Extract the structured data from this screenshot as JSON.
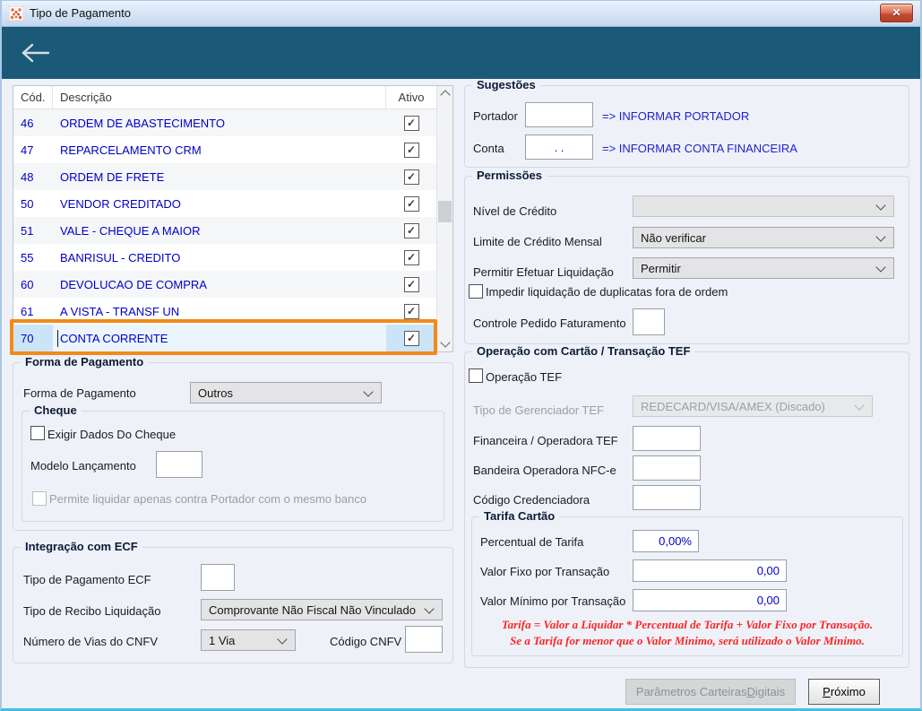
{
  "colors": {
    "header_teal": "#1A5A78",
    "highlight_orange": "#F28A1A",
    "link_blue": "#0000C8",
    "warning_red": "#FB2626",
    "selected_row_bg": "#CBE4F7"
  },
  "icons": {
    "check": "✓",
    "close": "✕"
  },
  "window": {
    "title": "Tipo de Pagamento"
  },
  "table": {
    "headers": {
      "code": "Cód.",
      "description": "Descrição",
      "active": "Ativo"
    },
    "rows": [
      {
        "code": "46",
        "desc": "ORDEM DE ABASTECIMENTO",
        "active": true
      },
      {
        "code": "47",
        "desc": "REPARCELAMENTO CRM",
        "active": true
      },
      {
        "code": "48",
        "desc": "ORDEM DE FRETE",
        "active": true
      },
      {
        "code": "50",
        "desc": "VENDOR CREDITADO",
        "active": true
      },
      {
        "code": "51",
        "desc": "VALE - CHEQUE  A MAIOR",
        "active": true
      },
      {
        "code": "55",
        "desc": "BANRISUL - CREDITO",
        "active": true
      },
      {
        "code": "60",
        "desc": "DEVOLUCAO DE COMPRA",
        "active": true
      },
      {
        "code": "61",
        "desc": "A VISTA - TRANSF UN",
        "active": true
      },
      {
        "code": "70",
        "desc": "CONTA CORRENTE",
        "active": true,
        "selected": true
      }
    ]
  },
  "forma_pagamento": {
    "group_title": "Forma de Pagamento",
    "label": "Forma de Pagamento",
    "value": "Outros",
    "cheque": {
      "group_title": "Cheque",
      "exigir_label": "Exigir Dados Do Cheque",
      "exigir_checked": false,
      "modelo_label": "Modelo Lançamento",
      "modelo_value": "",
      "permite_label": "Permite liquidar apenas contra Portador com o mesmo banco",
      "permite_checked": false,
      "permite_enabled": false
    }
  },
  "integracao_ecf": {
    "group_title": "Integração com ECF",
    "tipo_pagamento_label": "Tipo de Pagamento ECF",
    "tipo_pagamento_value": "",
    "tipo_recibo_label": "Tipo de Recibo Liquidação",
    "tipo_recibo_value": "Comprovante Não Fiscal Não Vinculado",
    "num_vias_label": "Número de Vias do CNFV",
    "num_vias_value": "1 Via",
    "codigo_cnfv_label": "Código CNFV",
    "codigo_cnfv_value": ""
  },
  "sugestoes": {
    "group_title": "Sugestões",
    "portador_label": "Portador",
    "portador_value": "",
    "portador_hint": "=> INFORMAR PORTADOR",
    "conta_label": "Conta",
    "conta_value": ".  .",
    "conta_hint": "=> INFORMAR CONTA FINANCEIRA"
  },
  "permissoes": {
    "group_title": "Permissões",
    "nivel_credito_label": "Nível de Crédito",
    "nivel_credito_value": "",
    "limite_credito_label": "Limite de Crédito Mensal",
    "limite_credito_value": "Não verificar",
    "permitir_liquidacao_label": "Permitir Efetuar Liquidação",
    "permitir_liquidacao_value": "Permitir",
    "impedir_label": "Impedir liquidação de duplicatas fora de ordem",
    "impedir_checked": false,
    "controle_pedido_label": "Controle Pedido Faturamento",
    "controle_pedido_value": ""
  },
  "operacao_tef": {
    "group_title": "Operação com Cartão / Transação TEF",
    "operacao_tef_label": "Operação TEF",
    "operacao_tef_checked": false,
    "gerenciador_label": "Tipo de Gerenciador TEF",
    "gerenciador_value": "REDECARD/VISA/AMEX (Discado)",
    "gerenciador_enabled": false,
    "financeira_label": "Financeira / Operadora TEF",
    "financeira_value": "",
    "bandeira_label": "Bandeira Operadora NFC-e",
    "bandeira_value": "",
    "credenciadora_label": "Código Credenciadora",
    "credenciadora_value": "",
    "tarifa": {
      "group_title": "Tarifa Cartão",
      "percentual_label": "Percentual de Tarifa",
      "percentual_value": "0,00%",
      "valor_fixo_label": "Valor Fixo por Transação",
      "valor_fixo_value": "0,00",
      "valor_minimo_label": "Valor Mínimo por Transação",
      "valor_minimo_value": "0,00",
      "note1": "Tarifa = Valor a Liquidar *  Percentual de Tarifa + Valor Fixo por Transação.",
      "note2": "Se a Tarifa for menor que o Valor Minimo, será utilizado o Valor Minimo."
    }
  },
  "footer": {
    "parametros_prefix": "Parâmetros Carteiras ",
    "parametros_accel": "D",
    "parametros_suffix": "igitais",
    "proximo_accel": "P",
    "proximo_suffix": "róximo"
  }
}
